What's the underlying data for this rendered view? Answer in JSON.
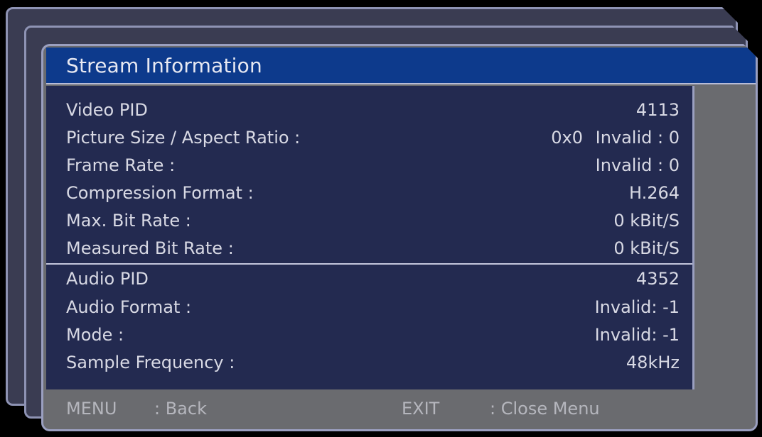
{
  "window": {
    "title": "Stream Information"
  },
  "video": {
    "rows": [
      {
        "label": "Video PID",
        "value": "4113"
      },
      {
        "label": "Picture Size / Aspect Ratio :",
        "value_prefix": "0x0",
        "value": "Invalid : 0"
      },
      {
        "label": "Frame Rate :",
        "value": "Invalid : 0"
      },
      {
        "label": "Compression Format :",
        "value": "H.264"
      },
      {
        "label": "Max. Bit Rate :",
        "value": "0 kBit/S"
      },
      {
        "label": "Measured Bit Rate :",
        "value": "0 kBit/S"
      }
    ]
  },
  "audio": {
    "rows": [
      {
        "label": "Audio PID",
        "value": "4352"
      },
      {
        "label": "Audio Format :",
        "value": "Invalid: -1"
      },
      {
        "label": "Mode :",
        "value": "Invalid: -1"
      },
      {
        "label": "Sample Frequency :",
        "value": "48kHz"
      }
    ]
  },
  "footer": {
    "menu_key": "MENU",
    "menu_action": ": Back",
    "exit_key": "EXIT",
    "exit_action": ": Close Menu"
  },
  "colors": {
    "title_bar": "#0d3a8c",
    "info_background": "#232a50",
    "panel_grey": "#6a6b6f",
    "border": "#9a9fc0",
    "text": "#d8d9e4",
    "footer_text": "#b5b6bd"
  }
}
